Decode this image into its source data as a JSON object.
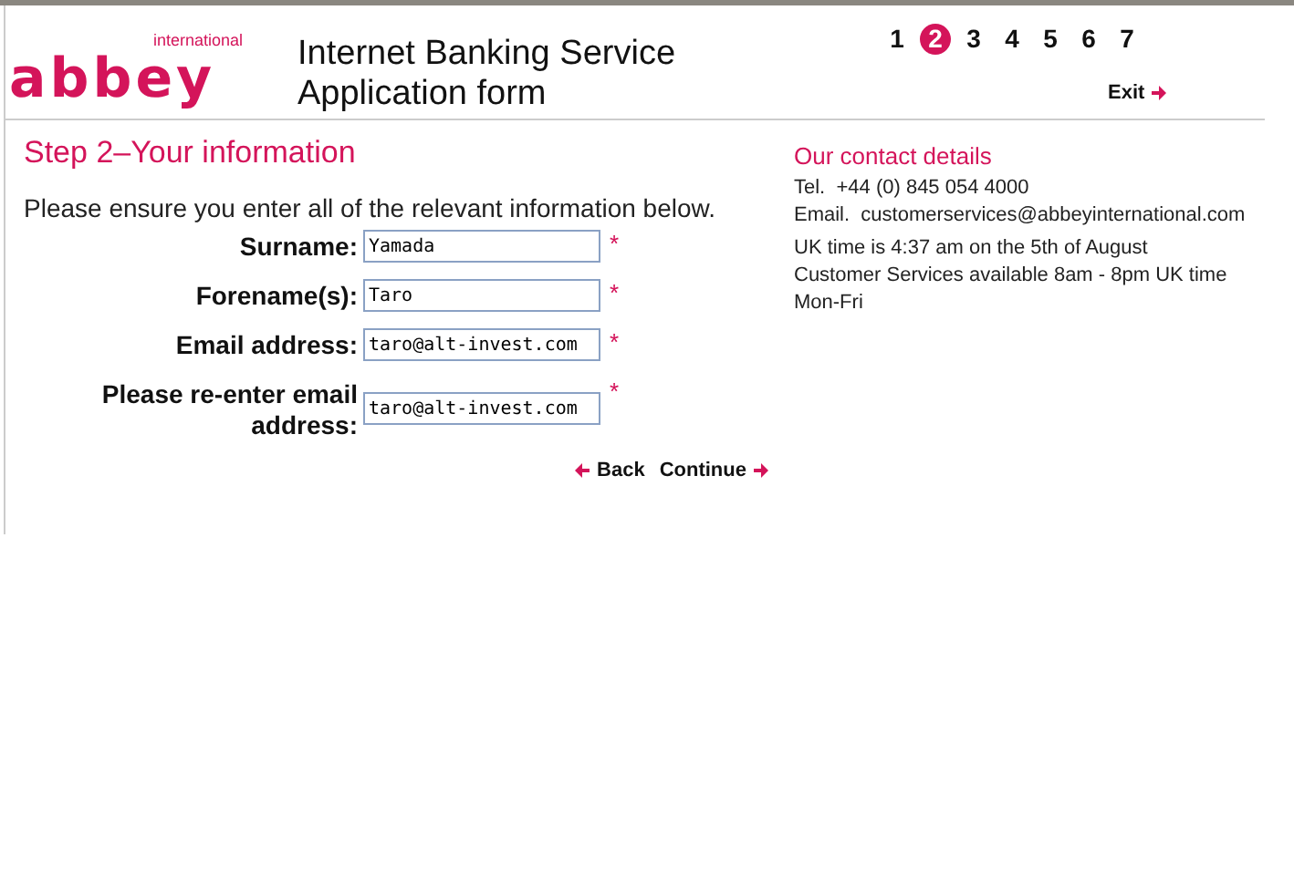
{
  "logo": {
    "brand": "abbey",
    "sub": "international"
  },
  "title_lines": [
    "Internet Banking Service",
    "Application form"
  ],
  "steps": [
    {
      "label": "1",
      "selected": false
    },
    {
      "label": "2",
      "selected": true
    },
    {
      "label": "3",
      "selected": false
    },
    {
      "label": "4",
      "selected": false
    },
    {
      "label": "5",
      "selected": false
    },
    {
      "label": "6",
      "selected": false
    },
    {
      "label": "7",
      "selected": false
    }
  ],
  "exit": "Exit",
  "heading": "Step 2–Your information",
  "intro": "Please ensure you enter all of the relevant information below.",
  "required_mark": "*",
  "fields": [
    {
      "label": "Surname:",
      "value": "Yamada",
      "required": true
    },
    {
      "label": "Forename(s):",
      "value": "Taro",
      "required": true
    },
    {
      "label": "Email address:",
      "value": "taro@alt-invest.com",
      "required": true
    },
    {
      "label": "Please re-enter email address:",
      "value": "taro@alt-invest.com",
      "required": true
    }
  ],
  "nav": {
    "back": "Back",
    "continue": "Continue"
  },
  "contact": {
    "title": "Our contact details",
    "lines": [
      "Tel.  +44 (0) 845 054 4000",
      "Email.  customerservices@abbeyinternational.com"
    ],
    "notes": [
      "UK time is 4:37 am on the 5th of August",
      "Customer Services available 8am - 8pm UK time",
      "Mon-Fri"
    ]
  }
}
